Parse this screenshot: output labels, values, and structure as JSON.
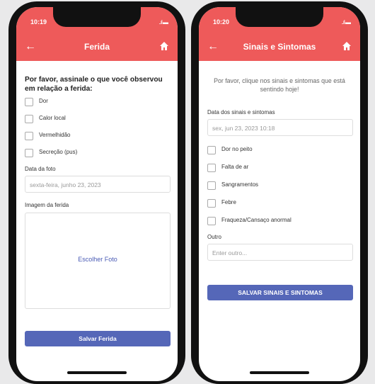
{
  "left": {
    "status_time": "10:19",
    "signal": "..ıl ▬",
    "title": "Ferida",
    "question": "Por favor, assinale o que você observou em relação a ferida:",
    "checkboxes": [
      "Dor",
      "Calor local",
      "Vermelhidão",
      "Secreção (pus)"
    ],
    "photo_date_label": "Data da foto",
    "photo_date_value": "sexta-feira, junho 23, 2023",
    "wound_image_label": "Imagem da ferida",
    "choose_photo": "Escolher Foto",
    "save_button": "Salvar Ferida"
  },
  "right": {
    "status_time": "10:20",
    "signal": "..ıl ▬",
    "title": "Sinais e Sintomas",
    "intro": "Por favor, clique nos sinais e sintomas que está sentindo hoje!",
    "date_label": "Data dos sinais e sintomas",
    "date_value": "sex, jun 23, 2023 10:18",
    "checkboxes": [
      "Dor no peito",
      "Falta de ar",
      "Sangramentos",
      "Febre",
      "Fraqueza/Cansaço anormal"
    ],
    "other_label": "Outro",
    "other_placeholder": "Enter outro...",
    "save_button": "SALVAR SINAIS E SINTOMAS"
  },
  "icons": {
    "back": "back-arrow-icon",
    "home": "home-icon",
    "signal": "signal-icon"
  },
  "colors": {
    "header": "#ee5a5a",
    "button": "#5567b8",
    "link": "#4a5bb5"
  }
}
